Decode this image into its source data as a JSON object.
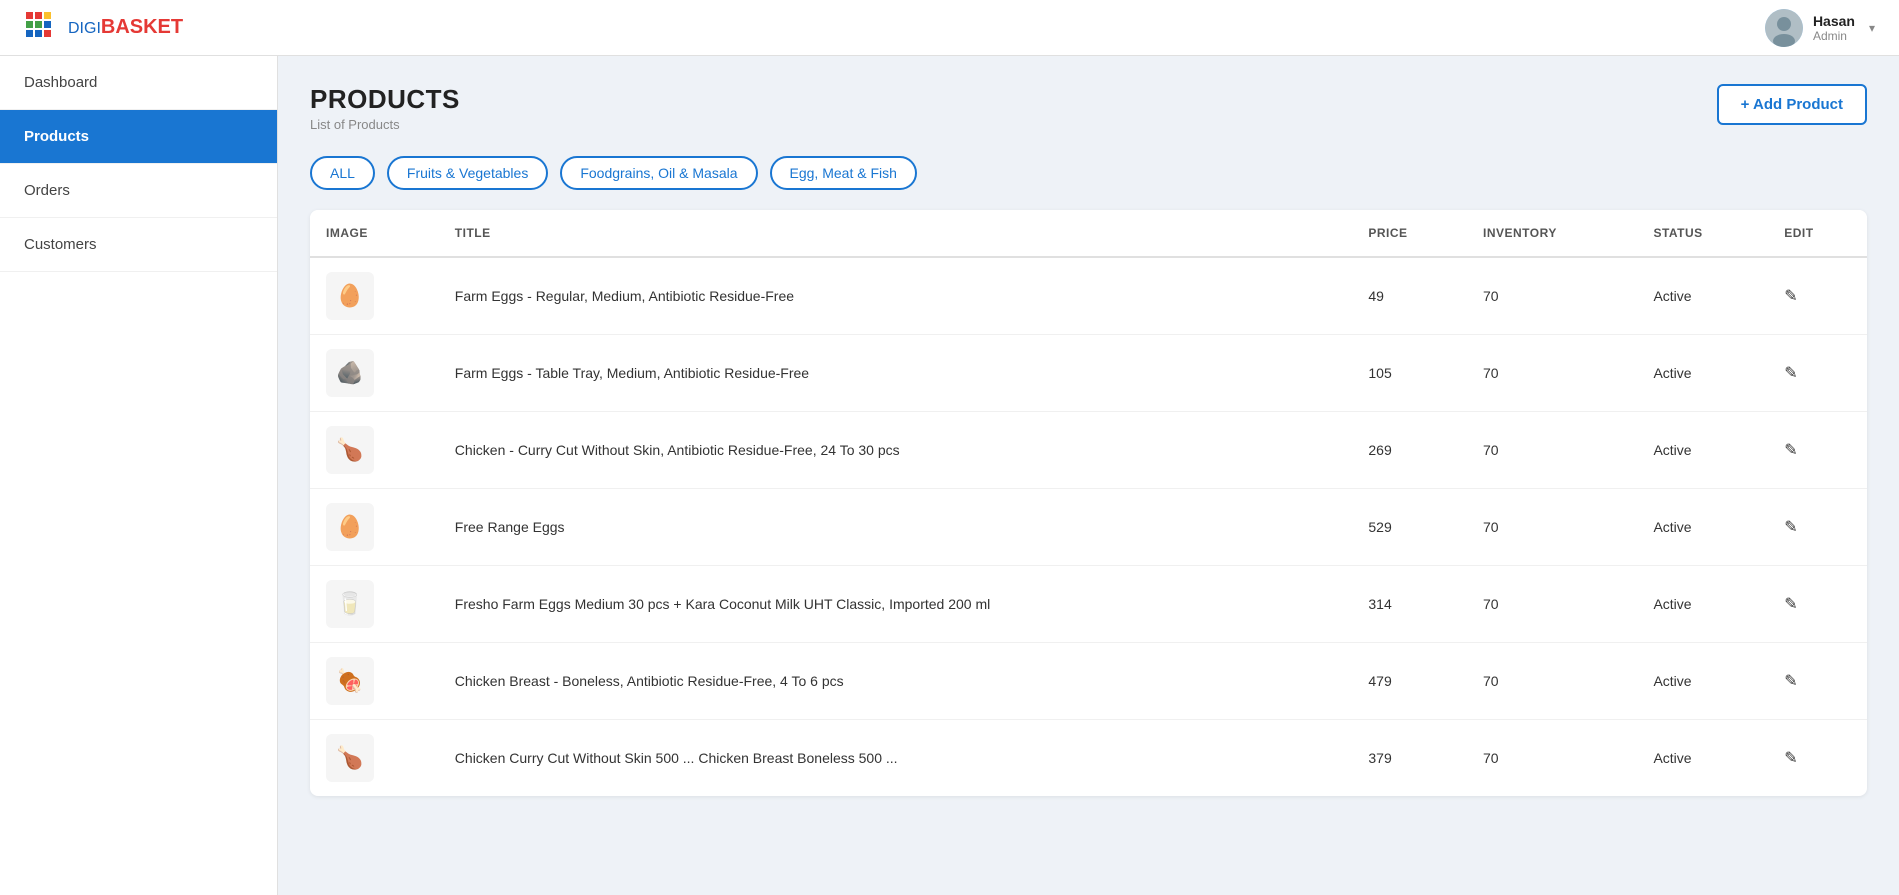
{
  "header": {
    "logo_digi": "DIGI",
    "logo_basket": "BASKET",
    "user_name": "Hasan",
    "user_role": "Admin"
  },
  "sidebar": {
    "items": [
      {
        "id": "dashboard",
        "label": "Dashboard",
        "active": false
      },
      {
        "id": "products",
        "label": "Products",
        "active": true
      },
      {
        "id": "orders",
        "label": "Orders",
        "active": false
      },
      {
        "id": "customers",
        "label": "Customers",
        "active": false
      }
    ]
  },
  "page": {
    "title": "PRODUCTS",
    "subtitle": "List of Products",
    "add_button_label": "+ Add Product"
  },
  "filters": [
    {
      "id": "all",
      "label": "ALL"
    },
    {
      "id": "fruits-veg",
      "label": "Fruits & Vegetables"
    },
    {
      "id": "foodgrains",
      "label": "Foodgrains, Oil & Masala"
    },
    {
      "id": "egg-meat-fish",
      "label": "Egg, Meat & Fish"
    }
  ],
  "table": {
    "columns": [
      {
        "id": "image",
        "label": "IMAGE"
      },
      {
        "id": "title",
        "label": "TITLE"
      },
      {
        "id": "price",
        "label": "PRICE"
      },
      {
        "id": "inventory",
        "label": "INVENTORY"
      },
      {
        "id": "status",
        "label": "STATUS"
      },
      {
        "id": "edit",
        "label": "EDIT"
      }
    ],
    "rows": [
      {
        "id": 1,
        "image_emoji": "🥚",
        "title": "Farm Eggs - Regular, Medium, Antibiotic Residue-Free",
        "price": "49",
        "inventory": "70",
        "status": "Active"
      },
      {
        "id": 2,
        "image_emoji": "🪨",
        "title": "Farm Eggs - Table Tray, Medium, Antibiotic Residue-Free",
        "price": "105",
        "inventory": "70",
        "status": "Active"
      },
      {
        "id": 3,
        "image_emoji": "🍗",
        "title": "Chicken - Curry Cut Without Skin, Antibiotic Residue-Free, 24 To 30 pcs",
        "price": "269",
        "inventory": "70",
        "status": "Active"
      },
      {
        "id": 4,
        "image_emoji": "🥚",
        "title": "Free Range Eggs",
        "price": "529",
        "inventory": "70",
        "status": "Active"
      },
      {
        "id": 5,
        "image_emoji": "🥛",
        "title": "Fresho Farm Eggs Medium 30 pcs + Kara Coconut Milk UHT Classic, Imported 200 ml",
        "price": "314",
        "inventory": "70",
        "status": "Active"
      },
      {
        "id": 6,
        "image_emoji": "🍖",
        "title": "Chicken Breast - Boneless, Antibiotic Residue-Free, 4 To 6 pcs",
        "price": "479",
        "inventory": "70",
        "status": "Active"
      },
      {
        "id": 7,
        "image_emoji": "🍗",
        "title": "Chicken Curry Cut Without Skin 500 ... Chicken Breast Boneless 500 ...",
        "price": "379",
        "inventory": "70",
        "status": "Active"
      }
    ]
  }
}
